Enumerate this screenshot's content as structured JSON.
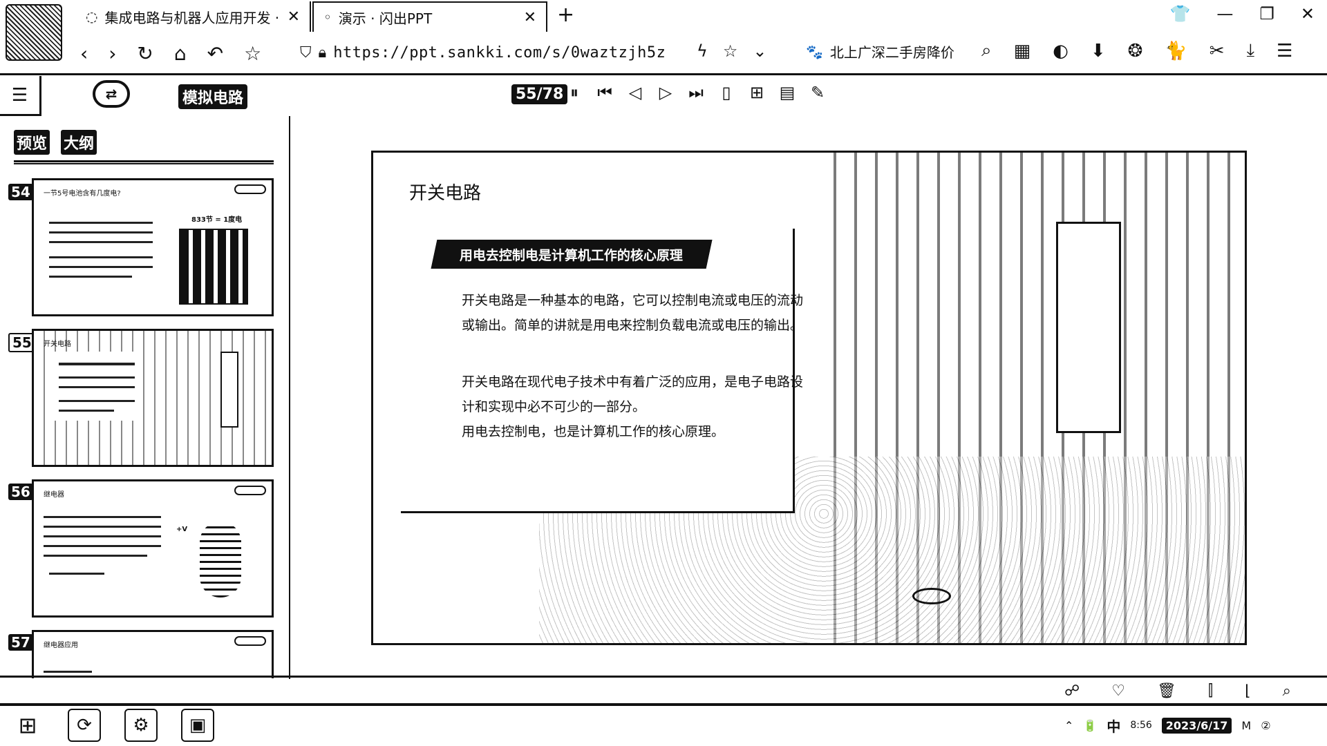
{
  "browser": {
    "tabs": [
      {
        "title": "集成电路与机器人应用开发 · 语",
        "close": "✕",
        "active": false
      },
      {
        "title": "演示 · 闪出PPT",
        "badge": "演示",
        "close": "✕",
        "active": true
      }
    ],
    "new_tab": "+",
    "window_controls": {
      "shirt": "👕",
      "minimize": "—",
      "restore": "❐",
      "close": "✕"
    },
    "nav": {
      "back": "‹",
      "forward": "›",
      "reload": "↻",
      "home": "⌂",
      "undo": "↶",
      "bookmark": "☆"
    },
    "url": "https://ppt.sankki.com/s/0waztzjh5z",
    "url_actions": {
      "bolt": "ϟ",
      "star": "☆",
      "dropdown": "⌄"
    },
    "hot_search": {
      "icon": "🐾",
      "text": "北上广深二手房降价"
    },
    "toolbar_icons": [
      "search-icon",
      "apps-icon",
      "moon-icon",
      "download-circle-icon",
      "openai-icon",
      "cat-icon",
      "scissors-icon",
      "download-icon",
      "menu-icon"
    ],
    "toolbar_glyphs": [
      "⌕",
      "▦",
      "◐",
      "⬇",
      "❂",
      "🐈",
      "✂",
      "⤓",
      "☰"
    ]
  },
  "viewer": {
    "sidebar_toggle": "☰",
    "brand": "⇄",
    "deck_title": "模拟电路",
    "page_counter": "55/78",
    "controls": [
      "⏸",
      "⏮",
      "◁",
      "▷",
      "⏭",
      "▯",
      "⊞",
      "▤",
      "✎"
    ]
  },
  "sidebar": {
    "tabs": {
      "preview": "预览",
      "outline": "大纲"
    },
    "slides": [
      {
        "num": "54",
        "title": "一节5号电池含有几度电?",
        "note": "833节 = 1度电",
        "active": false
      },
      {
        "num": "55",
        "title": "开关电路",
        "active": true
      },
      {
        "num": "56",
        "title": "继电器",
        "note": "+V",
        "active": false
      },
      {
        "num": "57",
        "title": "继电器应用",
        "active": false
      }
    ]
  },
  "slide": {
    "heading": "开关电路",
    "banner": "用电去控制电是计算机工作的核心原理",
    "paragraphs": [
      "开关电路是一种基本的电路，它可以控制电流或电压的流动或输出。简单的讲就是用电来控制负载电流或电压的输出。",
      "开关电路在现代电子技术中有着广泛的应用，是电子电路设计和实现中必不可少的一部分。",
      "用电去控制电，也是计算机工作的核心原理。"
    ]
  },
  "reactions": [
    "☍",
    "♡",
    "🗑",
    "⫿",
    "⌊",
    "⌕"
  ],
  "taskbar": {
    "start": "⊞",
    "apps": [
      "⟳",
      "⚙",
      "▣"
    ],
    "lang": "中",
    "time": "8:56",
    "date": "2023/6/17",
    "tray": [
      "⌃",
      "🔋",
      "M",
      "②"
    ]
  }
}
